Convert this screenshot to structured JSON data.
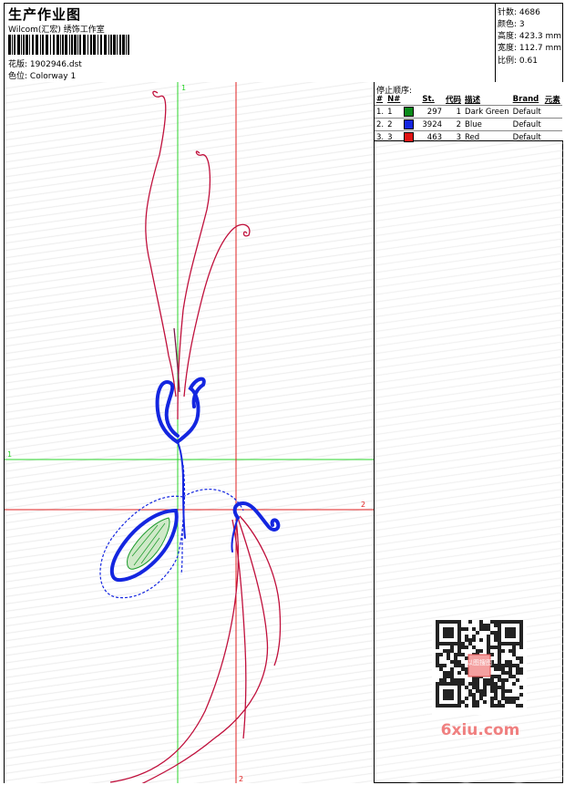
{
  "header": {
    "title": "生产作业图",
    "company": "Wilcom(汇宏) 绣饰工作室",
    "design_label": "花版:",
    "design_value": "1902946.dst",
    "colorway_label": "色位:",
    "colorway_value": "Colorway 1"
  },
  "stats": {
    "stitches": "针数: 4686",
    "colors": "颜色: 3",
    "height": "高度: 423.3 mm",
    "width": "宽度: 112.7 mm",
    "scale": "比例: 0.61"
  },
  "sequence": {
    "label": "停止顺序:",
    "headers": [
      "#",
      "N#",
      "St.",
      "代码",
      "描述",
      "Brand",
      "元素"
    ],
    "rows": [
      {
        "idx": "1.",
        "n": "1",
        "color": "#0a8a1a",
        "st": "297",
        "code": "1",
        "desc": "Dark Green",
        "brand": "Default"
      },
      {
        "idx": "2.",
        "n": "2",
        "color": "#1426e0",
        "st": "3924",
        "code": "2",
        "desc": "Blue",
        "brand": "Default"
      },
      {
        "idx": "3.",
        "n": "3",
        "color": "#e01414",
        "st": "463",
        "code": "3",
        "desc": "Red",
        "brand": "Default"
      }
    ]
  },
  "guides": {
    "green_v": "1",
    "green_h": "1",
    "red_h": "2",
    "red_v": "2"
  },
  "watermark": {
    "text": "6xiu.com",
    "stamp": "以图搜图"
  },
  "colors": {
    "green_guide": "#2bd42b",
    "red_guide": "#e02020",
    "thread_red": "#c0103c",
    "thread_blue": "#1426e0",
    "thread_green": "#1a9a2a"
  }
}
